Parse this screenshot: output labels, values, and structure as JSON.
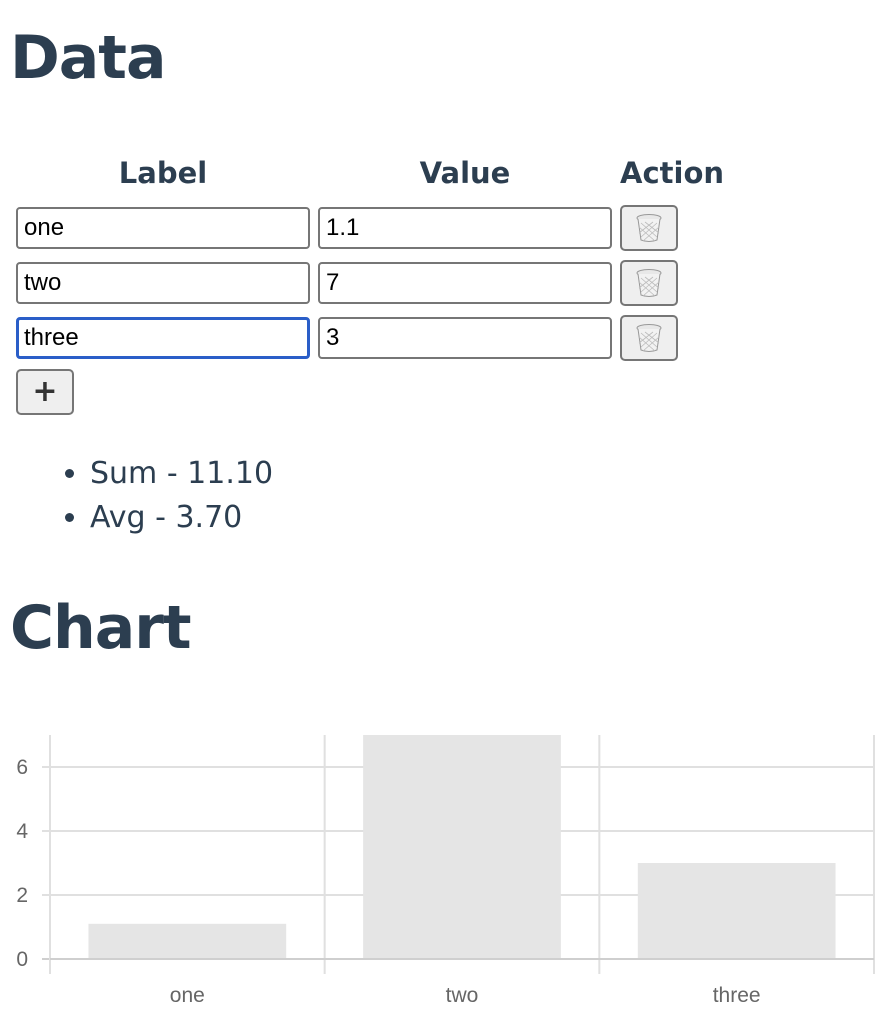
{
  "data_section": {
    "heading": "Data",
    "columns": {
      "label": "Label",
      "value": "Value",
      "action": "Action"
    },
    "rows": [
      {
        "label": "one",
        "value": "1.1"
      },
      {
        "label": "two",
        "value": "7"
      },
      {
        "label": "three",
        "value": "3"
      }
    ],
    "add_button": "+",
    "delete_icon": "trash-icon"
  },
  "stats": {
    "sum": "Sum - 11.10",
    "avg": "Avg - 3.70"
  },
  "chart_section": {
    "heading": "Chart"
  },
  "colors": {
    "heading": "#2c3e50",
    "focus": "#2a5ec8",
    "bar": "#e5e5e5",
    "grid": "#e0e0e0",
    "tick_text": "#666666"
  },
  "chart_data": {
    "type": "bar",
    "categories": [
      "one",
      "two",
      "three"
    ],
    "values": [
      1.1,
      7,
      3
    ],
    "title": "",
    "xlabel": "",
    "ylabel": "",
    "ylim": [
      0,
      7
    ],
    "yticks": [
      0,
      2,
      4,
      6
    ],
    "grid": true,
    "legend": "none"
  }
}
